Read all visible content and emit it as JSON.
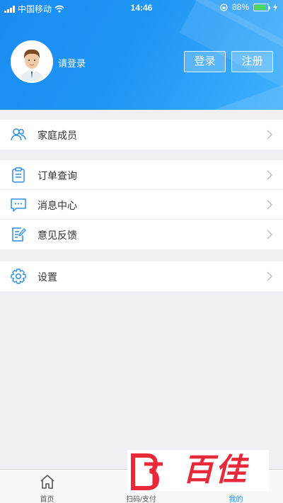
{
  "status_bar": {
    "carrier": "中国移动",
    "time": "14:46",
    "battery": "88%",
    "battery_level": 0.88
  },
  "header": {
    "login_hint": "请登录",
    "login_label": "登录",
    "register_label": "注册",
    "avatar_icon": "user-avatar"
  },
  "menu": {
    "family": "家庭成员",
    "orders": "订单查询",
    "messages": "消息中心",
    "feedback": "意见反馈",
    "settings": "设置"
  },
  "tabs": [
    {
      "label": "首页",
      "icon": "home-icon"
    },
    {
      "label": "扫码/支付",
      "icon": "scan-icon"
    },
    {
      "label": "我的",
      "icon": "profile-icon"
    }
  ],
  "watermark": "百佳",
  "colors": {
    "accent": "#1a8cf0",
    "icon": "#2f8de4",
    "watermark": "#e8293a"
  }
}
